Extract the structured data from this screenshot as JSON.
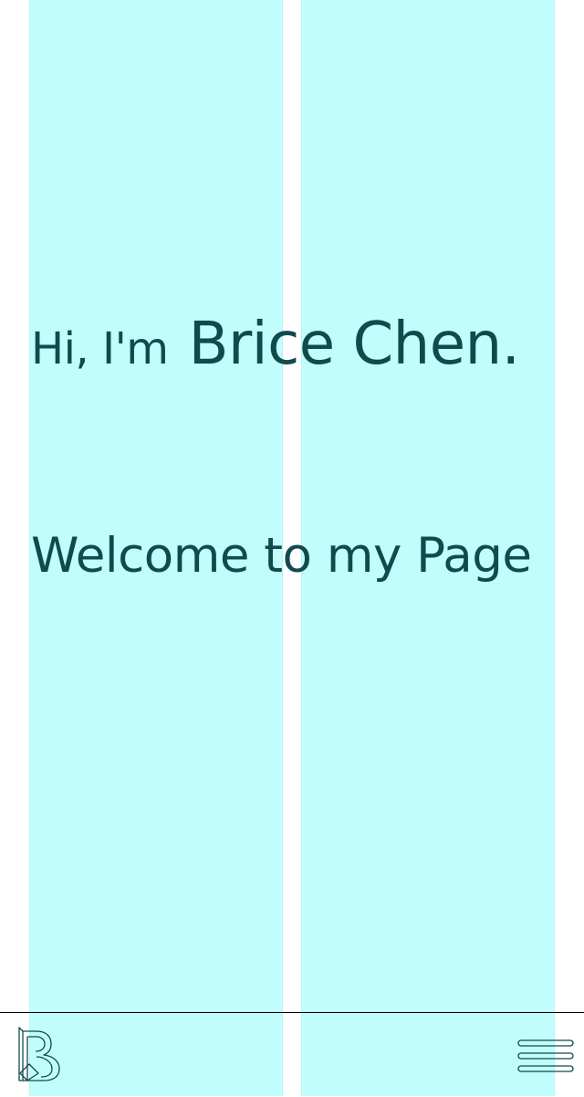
{
  "hero": {
    "greeting": "Hi, I'm",
    "name": "Brice Chen.",
    "welcome": "Welcome to my Page"
  },
  "nav": {
    "logo_icon": "letter-b-logo",
    "menu_icon": "hamburger-menu-icon"
  },
  "colors": {
    "grid_column": "#c1fdfc",
    "text": "#0f4a4d",
    "background": "#ffffff"
  }
}
